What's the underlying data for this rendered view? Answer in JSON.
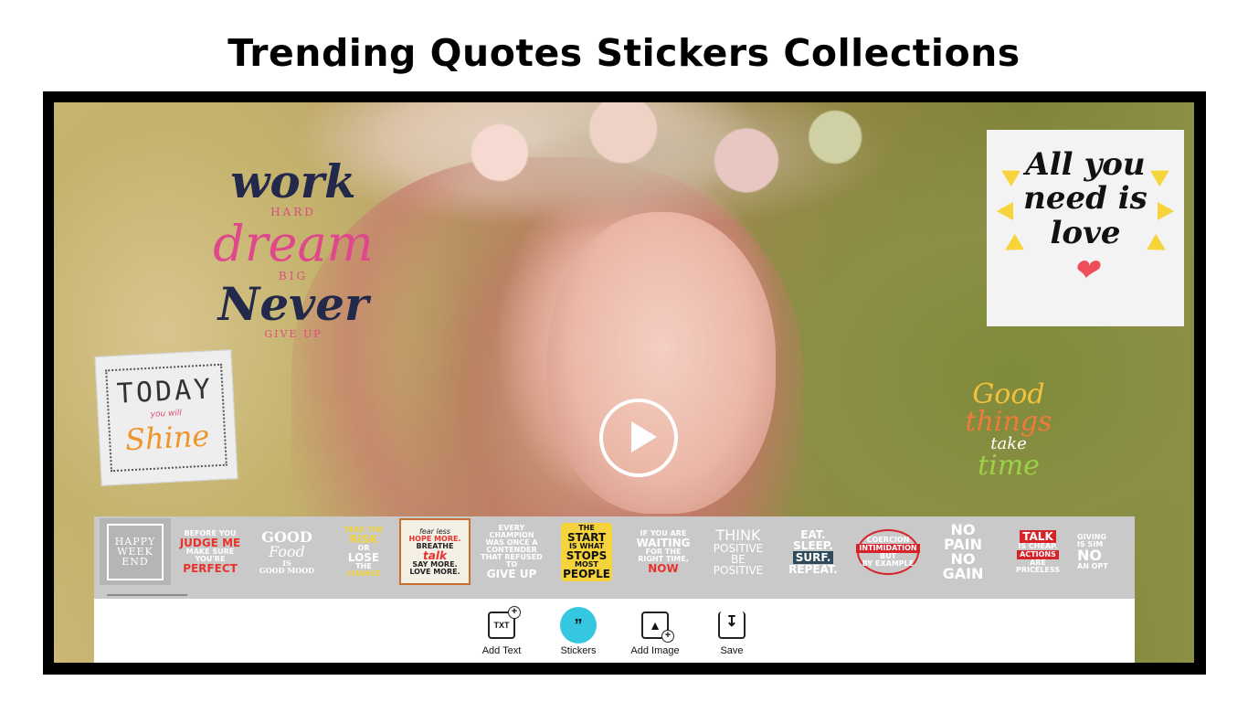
{
  "headline": "Trending Quotes Stickers Collections",
  "colors": {
    "accent": "#35c7e2",
    "selected_border": "#c8702a",
    "tray_bg": "#c9c9c9"
  },
  "stickers_on_canvas": {
    "work": {
      "l1": "work",
      "l2": "HARD",
      "l3": "dream",
      "l4": "BIG",
      "l5": "Never",
      "l6": "GIVE UP"
    },
    "today": {
      "l1": "TODAY",
      "l2": "you will",
      "l3": "Shine"
    },
    "love": {
      "l1": "All you",
      "l2": "need is",
      "l3": "love"
    },
    "good": {
      "l1": "Good",
      "l2": "things",
      "l3": "take",
      "l4": "time"
    }
  },
  "play_icon": "play-icon",
  "sticker_tray": [
    {
      "lines": [
        "HAPPY",
        "WEEK",
        "END"
      ]
    },
    {
      "lines": [
        "BEFORE YOU",
        "JUDGE ME",
        "MAKE SURE YOU'RE",
        "PERFECT"
      ]
    },
    {
      "lines": [
        "GOOD",
        "Food",
        "IS",
        "GOOD MOOD"
      ]
    },
    {
      "lines": [
        "TAKE THE",
        "RISK",
        "OR",
        "LOSE",
        "THE",
        "CHANCE"
      ]
    },
    {
      "lines": [
        "fear less",
        "HOPE MORE.",
        "BREATHE",
        "talk",
        "SAY MORE.",
        "LOVE MORE."
      ]
    },
    {
      "lines": [
        "EVERY CHAMPION",
        "WAS ONCE A",
        "CONTENDER",
        "THAT REFUSED TO",
        "GIVE UP"
      ]
    },
    {
      "lines": [
        "THE",
        "START",
        "IS WHAT",
        "STOPS",
        "MOST",
        "PEOPLE"
      ]
    },
    {
      "lines": [
        "IF YOU ARE",
        "WAITING",
        "FOR THE",
        "RIGHT TIME,",
        "NOW"
      ]
    },
    {
      "lines": [
        "THINK",
        "POSITIVE",
        "BE",
        "POSITIVE"
      ]
    },
    {
      "lines": [
        "EAT.",
        "SLEEP.",
        "SURF.",
        "REPEAT."
      ]
    },
    {
      "lines": [
        "COERCION",
        "INTIMIDATION",
        "BUT",
        "BY EXAMPLE"
      ]
    },
    {
      "lines": [
        "NO",
        "PAIN",
        "NO",
        "GAIN"
      ]
    },
    {
      "lines": [
        "TALK",
        "IS CHEAP.",
        "ACTIONS",
        "ARE",
        "PRICELESS"
      ]
    },
    {
      "lines": [
        "GIVING",
        "IS SIM",
        "NO",
        "AN OPT"
      ]
    }
  ],
  "toolbar": {
    "add_text": {
      "label": "Add Text",
      "icon_text": "TXT"
    },
    "stickers": {
      "label": "Stickers",
      "icon_text": "”"
    },
    "add_image": {
      "label": "Add Image"
    },
    "save": {
      "label": "Save"
    }
  }
}
